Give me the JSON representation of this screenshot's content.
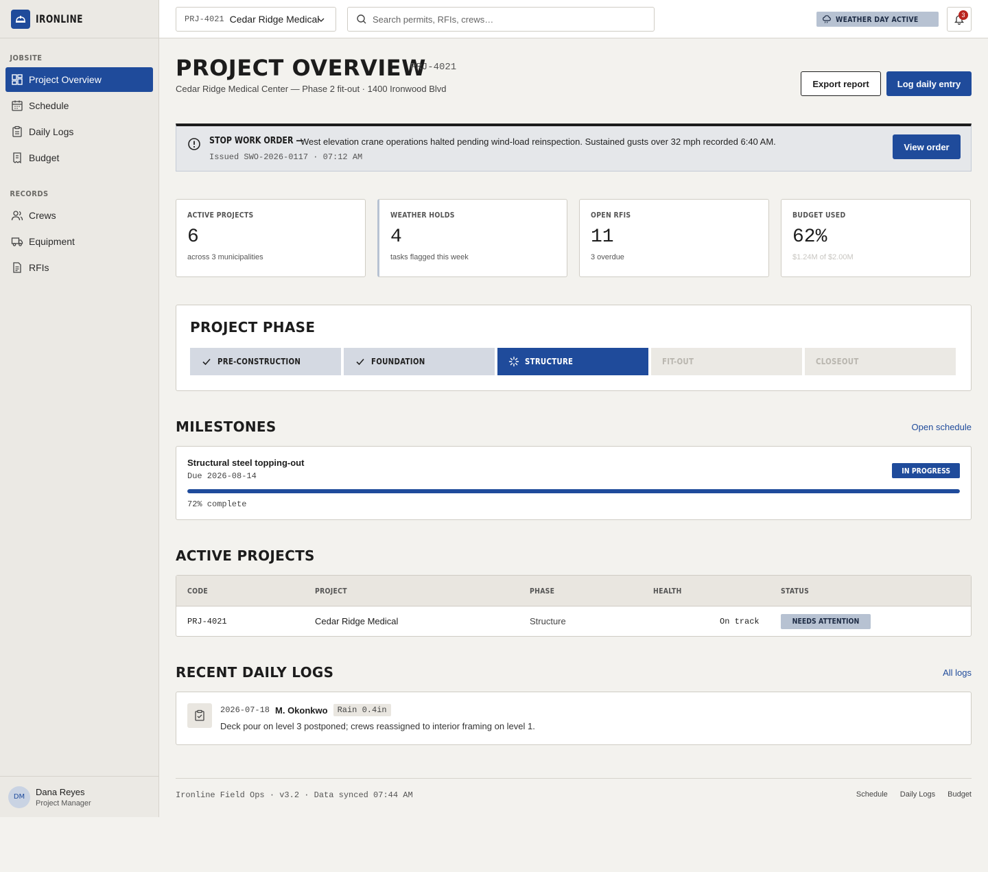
{
  "brand": {
    "name": "IRONLINE"
  },
  "sidebar": {
    "sections": [
      {
        "label": "JOBSITE",
        "items": [
          {
            "label": "Project Overview",
            "icon": "dashboard-icon",
            "active": true
          },
          {
            "label": "Schedule",
            "icon": "calendar-icon"
          },
          {
            "label": "Daily Logs",
            "icon": "clipboard-icon"
          },
          {
            "label": "Budget",
            "icon": "receipt-icon"
          }
        ]
      },
      {
        "label": "RECORDS",
        "items": [
          {
            "label": "Crews",
            "icon": "users-icon"
          },
          {
            "label": "Equipment",
            "icon": "truck-icon"
          },
          {
            "label": "RFIs",
            "icon": "document-icon"
          }
        ]
      }
    ],
    "user": {
      "initials": "DM",
      "name": "Dana Reyes",
      "role": "Project Manager"
    }
  },
  "topbar": {
    "project_code": "PRJ-4021",
    "project_name": "Cedar Ridge Medical",
    "search_placeholder": "Search permits, RFIs, crews…",
    "weather_pill": "WEATHER DAY ACTIVE",
    "notification_count": "3"
  },
  "header": {
    "title": "PROJECT OVERVIEW",
    "code": "PRJ-4021",
    "subtitle": "Cedar Ridge Medical Center — Phase 2 fit-out · 1400 Ironwood Blvd",
    "export_label": "Export report",
    "log_label": "Log daily entry"
  },
  "alert": {
    "title": "STOP WORK ORDER —",
    "text": "West elevation crane operations halted pending wind-load reinspection. Sustained gusts over 32 mph recorded 6:40 AM.",
    "meta": "Issued SWO-2026-0117 · 07:12 AM",
    "button": "View order"
  },
  "stats": [
    {
      "label": "ACTIVE PROJECTS",
      "value": "6",
      "note": "across 3 municipalities"
    },
    {
      "label": "WEATHER HOLDS",
      "value": "4",
      "note": "tasks flagged this week"
    },
    {
      "label": "OPEN RFIS",
      "value": "11",
      "note": "3 overdue"
    },
    {
      "label": "BUDGET USED",
      "value": "62%",
      "note": "$1.24M of $2.00M"
    }
  ],
  "phase": {
    "title": "PROJECT PHASE",
    "steps": [
      {
        "label": "PRE-CONSTRUCTION",
        "state": "done"
      },
      {
        "label": "FOUNDATION",
        "state": "done"
      },
      {
        "label": "STRUCTURE",
        "state": "current"
      },
      {
        "label": "FIT-OUT",
        "state": "todo"
      },
      {
        "label": "CLOSEOUT",
        "state": "todo"
      }
    ]
  },
  "milestones": {
    "title": "MILESTONES",
    "link": "Open schedule",
    "item": {
      "name": "Structural steel topping-out",
      "due": "Due 2026-08-14",
      "status": "IN PROGRESS",
      "progress_fraction": 1.0,
      "progress_text": "72% complete"
    }
  },
  "projects": {
    "title": "ACTIVE PROJECTS",
    "columns": [
      "CODE",
      "PROJECT",
      "PHASE",
      "HEALTH",
      "STATUS"
    ],
    "rows": [
      {
        "code": "PRJ-4021",
        "project": "Cedar Ridge Medical",
        "phase": "Structure",
        "health": "On track",
        "status": "NEEDS ATTENTION"
      }
    ]
  },
  "logs": {
    "title": "RECENT DAILY LOGS",
    "link": "All logs",
    "entries": [
      {
        "date": "2026-07-18",
        "author": "M. Okonkwo",
        "tag": "Rain 0.4in",
        "text": "Deck pour on level 3 postponed; crews reassigned to interior framing on level 1."
      }
    ]
  },
  "footer": {
    "text": "Ironline Field Ops · v3.2 · Data synced 07:44 AM",
    "links": [
      "Schedule",
      "Daily Logs",
      "Budget"
    ]
  },
  "colors": {
    "accent": "#1f4b9b",
    "alert_red": "#b9241f",
    "badge_gray": "#b7c2d2"
  }
}
